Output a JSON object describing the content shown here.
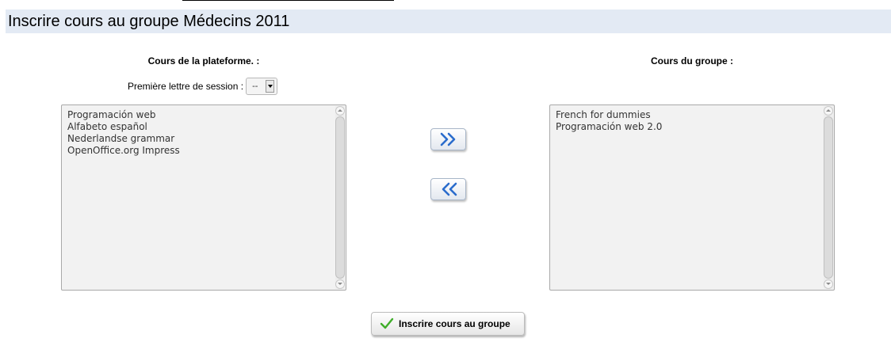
{
  "page": {
    "title": "Inscrire cours au groupe Médecins 2011"
  },
  "left_panel": {
    "heading": "Cours de la plateforme. :",
    "filter_label": "Première lettre de session :",
    "filter_value": "--",
    "courses": [
      "Programación web",
      "Alfabeto español",
      "Nederlandse grammar",
      "OpenOffice.org Impress"
    ]
  },
  "right_panel": {
    "heading": "Cours du groupe :",
    "courses": [
      "French for dummies",
      "Programación web 2.0"
    ]
  },
  "actions": {
    "add_icon": "double-chevron-right-icon",
    "remove_icon": "double-chevron-left-icon",
    "submit_label": "Inscrire cours au groupe",
    "submit_icon": "checkmark-icon"
  },
  "colors": {
    "title_bar_bg": "#e3eaf4",
    "arrow_blue": "#2a6ccc",
    "check_green": "#3fae29"
  }
}
